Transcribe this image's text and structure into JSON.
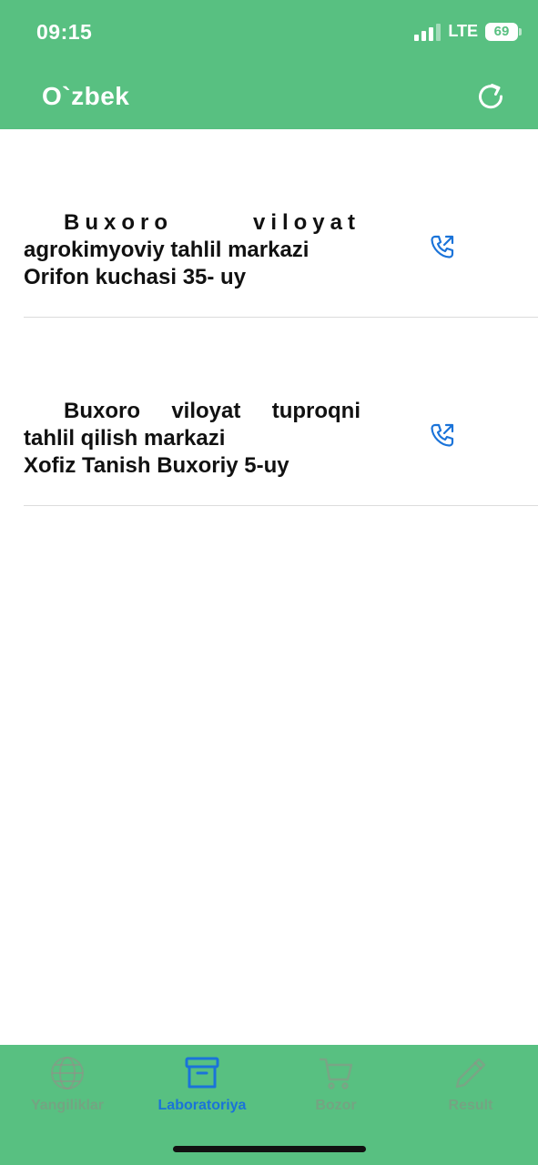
{
  "status_bar": {
    "time": "09:15",
    "network": "LTE",
    "battery": "69"
  },
  "app_bar": {
    "title": "O`zbek",
    "refresh_icon": "refresh-icon"
  },
  "items": [
    {
      "line1": "Buxoro viloyat",
      "line2": "agrokimyoviy tahlil markazi",
      "line3": "Orifon kuchasi 35- uy",
      "icon": "phone-call-icon"
    },
    {
      "line1": "Buxoro viloyat tuproqni",
      "line2": "tahlil qilish markazi",
      "line3": "Xofiz Tanish Buxoriy 5-uy",
      "icon": "phone-call-icon"
    }
  ],
  "bottom_nav": {
    "tabs": [
      {
        "label": "Yangiliklar",
        "icon": "globe-icon",
        "active": false
      },
      {
        "label": "Laboratoriya",
        "icon": "archive-box-icon",
        "active": true
      },
      {
        "label": "Bozor",
        "icon": "cart-icon",
        "active": false
      },
      {
        "label": "Result",
        "icon": "pencil-icon",
        "active": false
      }
    ]
  },
  "colors": {
    "primary_green": "#58c081",
    "active_blue": "#1a73d9",
    "inactive_tab": "#9a8a8a",
    "text_dark": "#111111"
  }
}
